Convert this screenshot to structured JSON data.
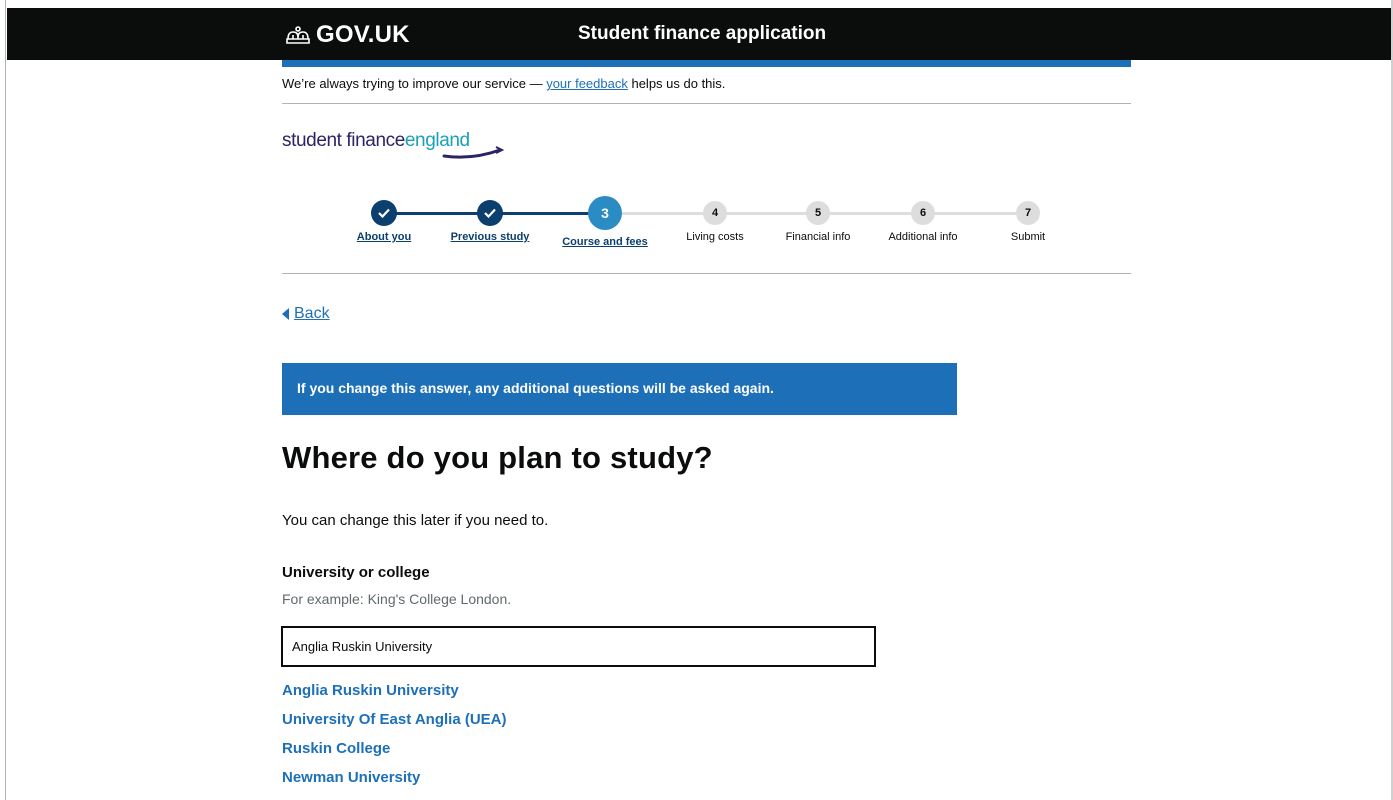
{
  "header": {
    "logo_text": "GOV.UK",
    "service_name": "Student finance application"
  },
  "feedback": {
    "prefix": "We’re always trying to improve our service — ",
    "link": "your feedback",
    "suffix": " helps us do this."
  },
  "brand": {
    "part1": "student finance",
    "part2": "england"
  },
  "stepper": {
    "steps": [
      {
        "number": "",
        "label": "About you",
        "state": "done"
      },
      {
        "number": "",
        "label": "Previous study",
        "state": "done"
      },
      {
        "number": "3",
        "label": "Course and fees",
        "state": "current"
      },
      {
        "number": "4",
        "label": "Living costs",
        "state": "todo"
      },
      {
        "number": "5",
        "label": "Financial info",
        "state": "todo"
      },
      {
        "number": "6",
        "label": "Additional info",
        "state": "todo"
      },
      {
        "number": "7",
        "label": "Submit",
        "state": "todo"
      }
    ]
  },
  "back": {
    "label": "Back"
  },
  "banner": {
    "text": "If you change this answer, any additional questions will be asked again."
  },
  "main": {
    "title": "Where do you plan to study?",
    "hint": "You can change this later if you need to."
  },
  "form": {
    "label": "University or college",
    "hint": "For example: King's College London.",
    "value": "Anglia Ruskin University"
  },
  "suggestions": [
    "Anglia Ruskin University",
    "University Of East Anglia (UEA)",
    "Ruskin College",
    "Newman University"
  ],
  "colors": {
    "header_bg": "#0b0c0c",
    "accent_blue": "#1d70b8",
    "done_step": "#0b3f6e",
    "todo_step": "#dddddd"
  }
}
